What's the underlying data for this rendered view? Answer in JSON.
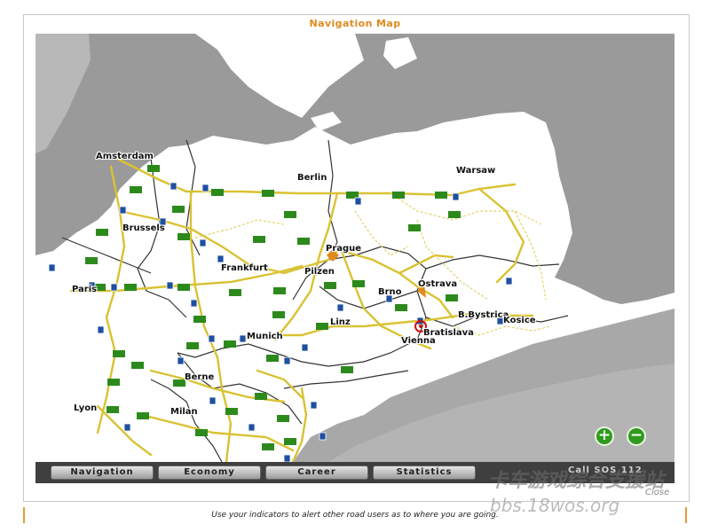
{
  "window": {
    "title": "Navigation Map"
  },
  "map": {
    "cities": [
      {
        "name": "Amsterdam",
        "id": "amsterdam"
      },
      {
        "name": "Berlin",
        "id": "berlin"
      },
      {
        "name": "Warsaw",
        "id": "warsaw"
      },
      {
        "name": "Brussels",
        "id": "brussels"
      },
      {
        "name": "Prague",
        "id": "prague"
      },
      {
        "name": "Frankfurt",
        "id": "frankfurt"
      },
      {
        "name": "Pilzen",
        "id": "pilzen"
      },
      {
        "name": "Paris",
        "id": "paris"
      },
      {
        "name": "Ostrava",
        "id": "ostrava"
      },
      {
        "name": "Brno",
        "id": "brno"
      },
      {
        "name": "B.Bystrica",
        "id": "bbystrica"
      },
      {
        "name": "Kosice",
        "id": "kosice"
      },
      {
        "name": "Linz",
        "id": "linz"
      },
      {
        "name": "Munich",
        "id": "munich"
      },
      {
        "name": "Bratislava",
        "id": "bratislava"
      },
      {
        "name": "Vienna",
        "id": "vienna"
      },
      {
        "name": "Berne",
        "id": "berne"
      },
      {
        "name": "Lyon",
        "id": "lyon"
      },
      {
        "name": "Milan",
        "id": "milan"
      }
    ],
    "zoom_in_symbol": "+",
    "zoom_out_symbol": "−",
    "accent_green": "#2f9a1e"
  },
  "toolbar": {
    "tabs": [
      "Navigation",
      "Economy",
      "Career",
      "Statistics"
    ],
    "call_sos": "Call SOS 112",
    "close": "Close"
  },
  "watermark": {
    "line1": "卡车游戏综合支援站",
    "line2": "bbs.18wos.org"
  },
  "hint": "Use your indicators to alert other road users as to where you are going.",
  "colors": {
    "title": "#e08a1e",
    "sea": "#9a9a9a",
    "land": "#ffffff",
    "hint_border": "#e69a3a"
  }
}
